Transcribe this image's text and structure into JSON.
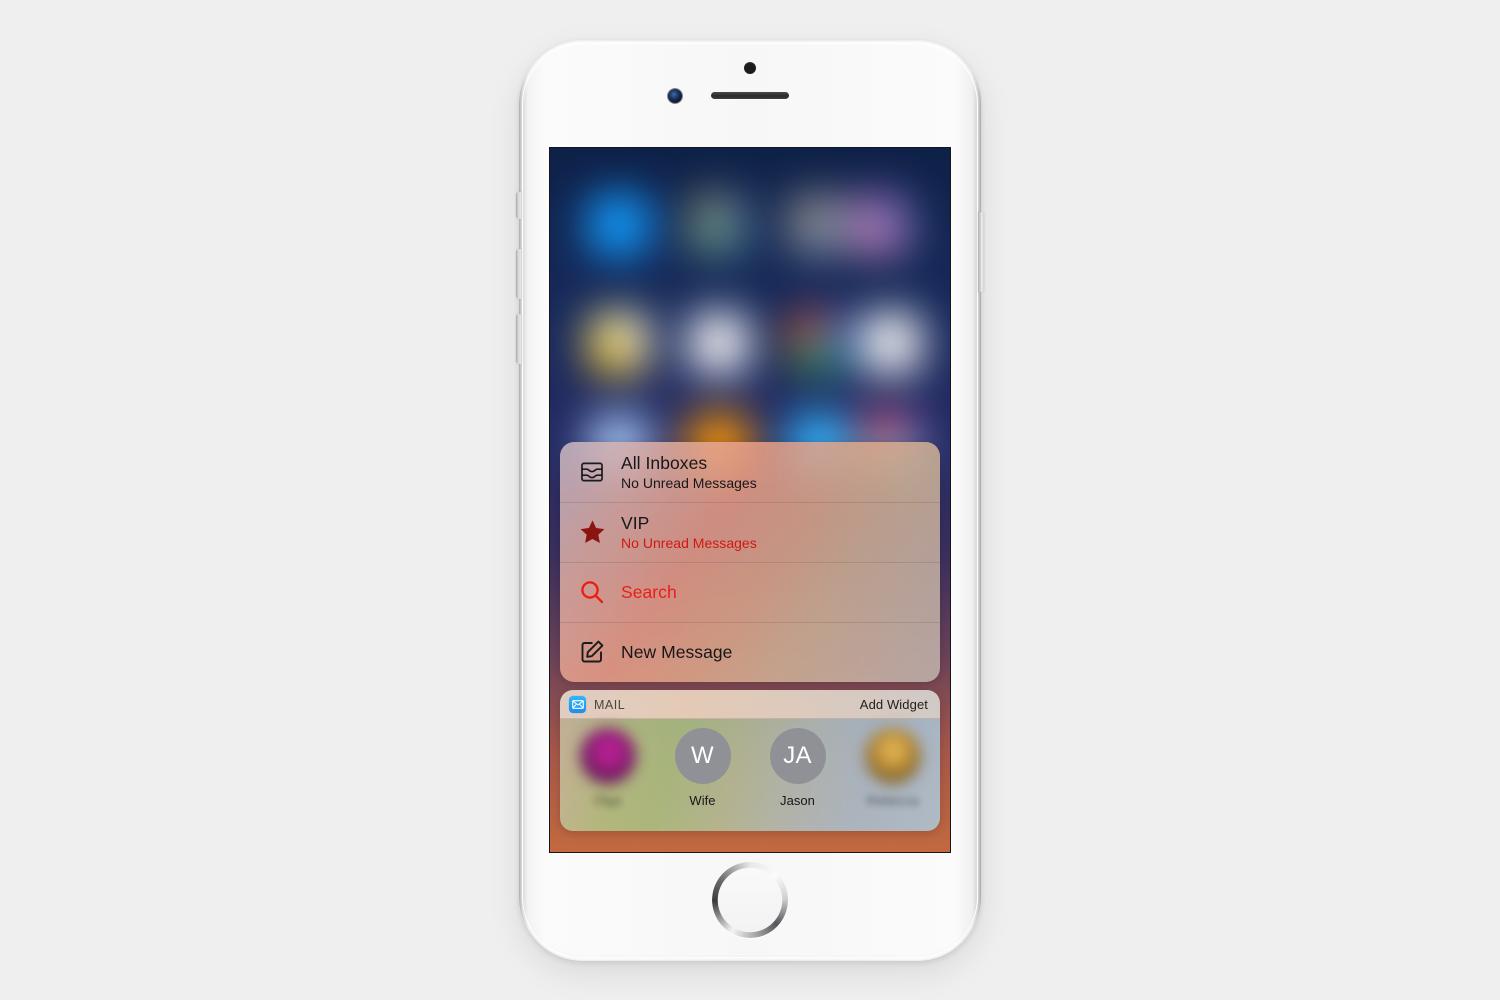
{
  "device": {
    "name": "iPhone",
    "body_color": "#f7f7f7",
    "hardware": {
      "sensor": "proximity-sensor",
      "speaker": "earpiece-speaker",
      "camera": "front-camera",
      "home": "home-button",
      "silent_switch": "ring-silent-switch",
      "volume_up": "volume-up-button",
      "volume_down": "volume-down-button",
      "power": "power-button"
    }
  },
  "screen": {
    "wallpaper": {
      "description": "blurred home screen",
      "gradient_top": "#0e2148",
      "gradient_bottom": "#c2693f",
      "icon_rows": 3,
      "icon_columns": 4,
      "icon_colors": [
        [
          "#1f9bff",
          "#6b8f7a",
          "#7b8a9b",
          "#c07fae"
        ],
        [
          "#f0c020",
          "#f2f2f4",
          "#2e9b4e",
          "#f4f4f6"
        ],
        [
          "#a9c6ef",
          "#ff9a0e",
          "#3fb6f5",
          "#4fb39a"
        ]
      ]
    },
    "quick_actions": {
      "accent_color": "#e8201a",
      "items": [
        {
          "icon": "inbox-tray-icon",
          "title": "All Inboxes",
          "subtitle": "No Unread Messages",
          "title_accent": false,
          "subtitle_accent": false
        },
        {
          "icon": "star-icon",
          "title": "VIP",
          "subtitle": "No Unread Messages",
          "title_accent": false,
          "subtitle_accent": true
        },
        {
          "icon": "search-icon",
          "title": "Search",
          "subtitle": "",
          "title_accent": true,
          "subtitle_accent": false
        },
        {
          "icon": "compose-icon",
          "title": "New Message",
          "subtitle": "",
          "title_accent": false,
          "subtitle_accent": false
        }
      ]
    },
    "widget": {
      "app_icon": "mail-envelope-icon",
      "app_icon_color": "#1a8ef3",
      "label": "MAIL",
      "add_widget_label": "Add Widget",
      "contacts": [
        {
          "name": "Olga",
          "avatar_type": "photo",
          "initials": "",
          "redacted": true
        },
        {
          "name": "Wife",
          "avatar_type": "initials",
          "initials": "W",
          "redacted": false
        },
        {
          "name": "Jason",
          "avatar_type": "initials",
          "initials": "JA",
          "redacted": false
        },
        {
          "name": "Rebecca",
          "avatar_type": "photo",
          "initials": "",
          "redacted": true
        }
      ]
    }
  }
}
